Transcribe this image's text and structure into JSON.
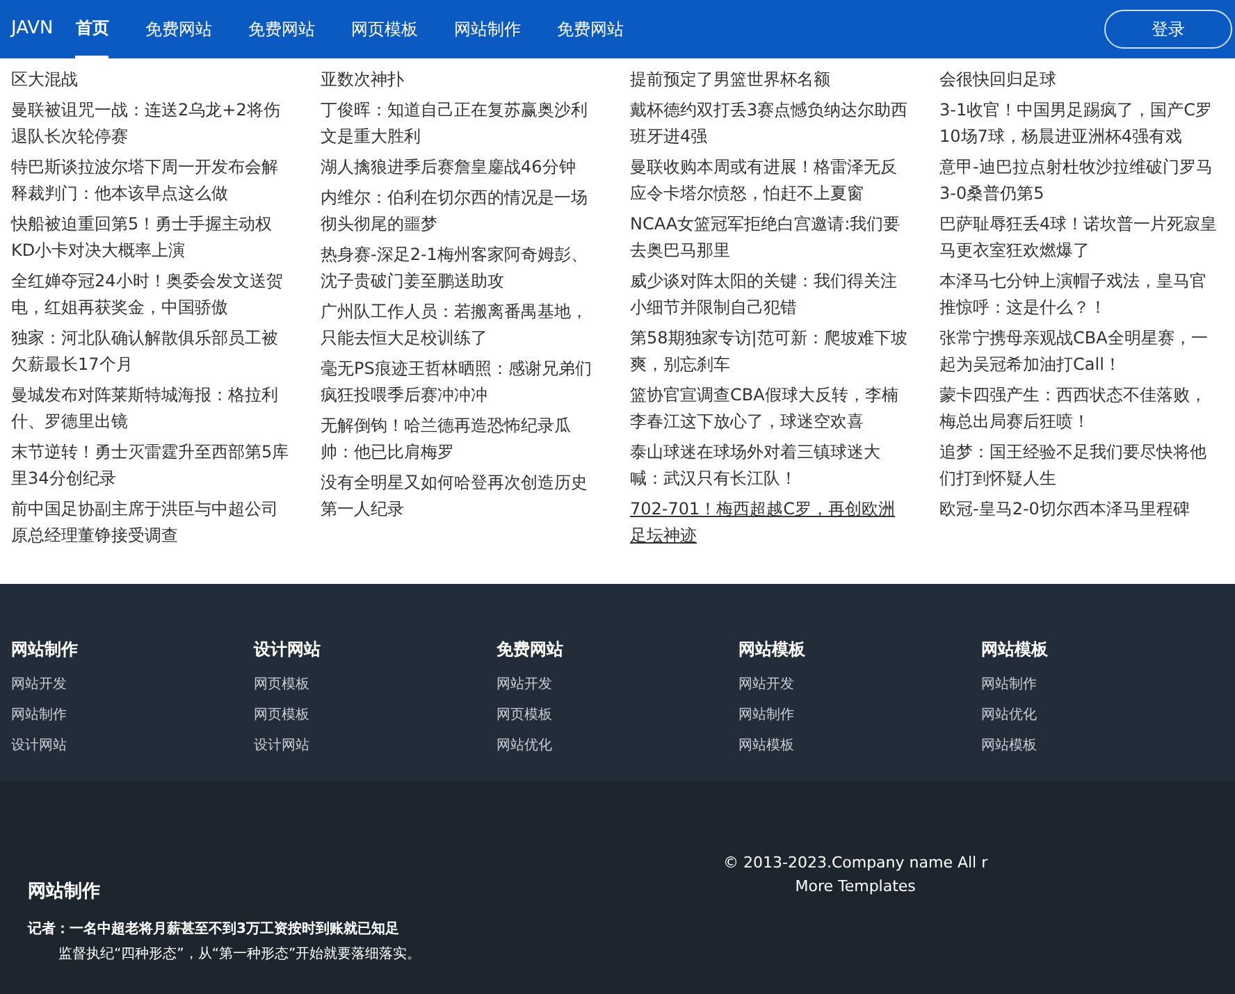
{
  "nav": {
    "brand": "JAVN",
    "items": [
      {
        "label": "首页",
        "selected": true
      },
      {
        "label": "免费网站",
        "selected": false
      },
      {
        "label": "免费网站",
        "selected": false
      },
      {
        "label": "网页模板",
        "selected": false
      },
      {
        "label": "网站制作",
        "selected": false
      },
      {
        "label": "免费网站",
        "selected": false
      }
    ],
    "login": "登录"
  },
  "news_columns": [
    [
      {
        "title": "区大混战",
        "hovered": false
      },
      {
        "title": "曼联被诅咒一战：连送2乌龙+2将伤退队长次轮停赛",
        "hovered": false
      },
      {
        "title": "特巴斯谈拉波尔塔下周一开发布会解释裁判门：他本该早点这么做",
        "hovered": false
      },
      {
        "title": "快船被迫重回第5！勇士手握主动权KD小卡对决大概率上演",
        "hovered": false
      },
      {
        "title": "全红婵夺冠24小时！奥委会发文送贺电，红姐再获奖金，中国骄傲",
        "hovered": false
      },
      {
        "title": "独家：河北队确认解散俱乐部员工被欠薪最长17个月",
        "hovered": false
      },
      {
        "title": "曼城发布对阵莱斯特城海报：格拉利什、罗德里出镜",
        "hovered": false
      },
      {
        "title": "末节逆转！勇士灭雷霆升至西部第5库里34分创纪录",
        "hovered": false
      },
      {
        "title": "前中国足协副主席于洪臣与中超公司原总经理董铮接受调查",
        "hovered": false
      }
    ],
    [
      {
        "title": "亚数次神扑",
        "hovered": false
      },
      {
        "title": "丁俊晖：知道自己正在复苏赢奥沙利文是重大胜利",
        "hovered": false
      },
      {
        "title": "湖人擒狼进季后赛詹皇鏖战46分钟",
        "hovered": false
      },
      {
        "title": "内维尔：伯利在切尔西的情况是一场彻头彻尾的噩梦",
        "hovered": false
      },
      {
        "title": "热身赛-深足2-1梅州客家阿奇姆彭、沈子贵破门姜至鹏送助攻",
        "hovered": false
      },
      {
        "title": "广州队工作人员：若搬离番禺基地，只能去恒大足校训练了",
        "hovered": false
      },
      {
        "title": "毫无PS痕迹王哲林晒照：感谢兄弟们疯狂投喂季后赛冲冲冲",
        "hovered": false
      },
      {
        "title": "无解倒钩！哈兰德再造恐怖纪录瓜帅：他已比肩梅罗",
        "hovered": false
      },
      {
        "title": "没有全明星又如何哈登再次创造历史第一人纪录",
        "hovered": false
      }
    ],
    [
      {
        "title": "提前预定了男篮世界杯名额",
        "hovered": false
      },
      {
        "title": "戴杯德约双打丢3赛点憾负纳达尔助西班牙进4强",
        "hovered": false
      },
      {
        "title": "曼联收购本周或有进展！格雷泽无反应令卡塔尔愤怒，怕赶不上夏窗",
        "hovered": false
      },
      {
        "title": "NCAA女篮冠军拒绝白宫邀请:我们要去奥巴马那里",
        "hovered": false
      },
      {
        "title": "威少谈对阵太阳的关键：我们得关注小细节并限制自己犯错",
        "hovered": false
      },
      {
        "title": "第58期独家专访|范可新：爬坡难下坡爽，别忘刹车",
        "hovered": false
      },
      {
        "title": "篮协官宣调查CBA假球大反转，李楠李春江这下放心了，球迷空欢喜",
        "hovered": false
      },
      {
        "title": "泰山球迷在球场外对着三镇球迷大喊：武汉只有长江队！",
        "hovered": false
      },
      {
        "title": "702-701！梅西超越C罗，再创欧洲足坛神迹",
        "hovered": true
      }
    ],
    [
      {
        "title": "会很快回归足球",
        "hovered": false
      },
      {
        "title": "3-1收官！中国男足踢疯了，国产C罗10场7球，杨晨进亚洲杯4强有戏",
        "hovered": false
      },
      {
        "title": "意甲-迪巴拉点射杜牧沙拉维破门罗马3-0桑普仍第5",
        "hovered": false
      },
      {
        "title": "巴萨耻辱狂丢4球！诺坎普一片死寂皇马更衣室狂欢燃爆了",
        "hovered": false
      },
      {
        "title": "本泽马七分钟上演帽子戏法，皇马官推惊呼：这是什么？！",
        "hovered": false
      },
      {
        "title": "张常宁携母亲观战CBA全明星赛，一起为吴冠希加油打Call！",
        "hovered": false
      },
      {
        "title": "蒙卡四强产生：西西状态不佳落败，梅总出局赛后狂喷！",
        "hovered": false
      },
      {
        "title": "追梦：国王经验不足我们要尽快将他们打到怀疑人生",
        "hovered": false
      },
      {
        "title": "欧冠-皇马2-0切尔西本泽马里程碑",
        "hovered": false
      }
    ]
  ],
  "footer_columns": [
    {
      "heading": "网站制作",
      "links": [
        "网站开发",
        "网站制作",
        "设计网站"
      ]
    },
    {
      "heading": "设计网站",
      "links": [
        "网页模板",
        "网页模板",
        "设计网站"
      ]
    },
    {
      "heading": "免费网站",
      "links": [
        "网站开发",
        "网页模板",
        "网站优化"
      ]
    },
    {
      "heading": "网站模板",
      "links": [
        "网站开发",
        "网站制作",
        "网站模板"
      ]
    },
    {
      "heading": "网站模板",
      "links": [
        "网站制作",
        "网站优化",
        "网站模板"
      ]
    }
  ],
  "bottom": {
    "title": "网站制作",
    "lead": "记者：一名中超老将月薪甚至不到3万工资按时到账就已知足",
    "body": "监督执纪“四种形态”，从“第一种形态”开始就要落细落实。",
    "copyright": "© 2013-2023.Company name All r",
    "more": "More Templates"
  }
}
